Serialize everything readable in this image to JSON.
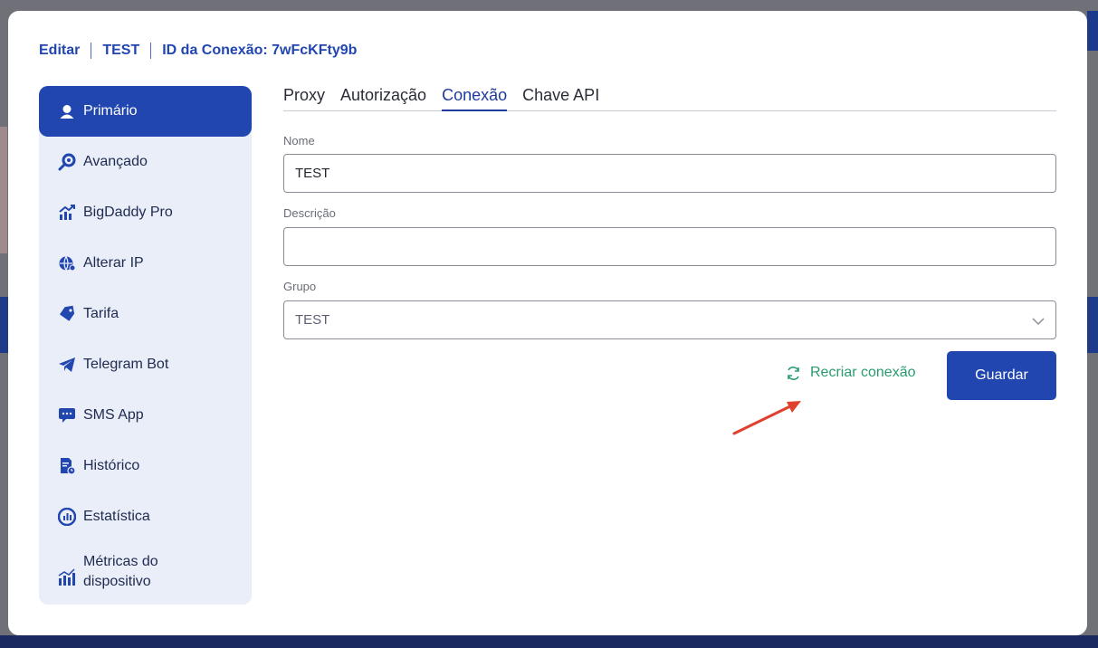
{
  "header": {
    "edit_label": "Editar",
    "name": "TEST",
    "connection_id": "ID da Conexão: 7wFcKFty9b"
  },
  "sidebar": {
    "items": [
      {
        "label": "Primário",
        "icon": "user-circle-icon",
        "active": true
      },
      {
        "label": "Avançado",
        "icon": "magnifier-gear-icon",
        "active": false
      },
      {
        "label": "BigDaddy Pro",
        "icon": "chart-growth-icon",
        "active": false
      },
      {
        "label": "Alterar IP",
        "icon": "globe-icon",
        "active": false
      },
      {
        "label": "Tarifa",
        "icon": "tag-icon",
        "active": false
      },
      {
        "label": "Telegram Bot",
        "icon": "paper-plane-icon",
        "active": false
      },
      {
        "label": "SMS App",
        "icon": "chat-bubble-icon",
        "active": false
      },
      {
        "label": "Histórico",
        "icon": "document-history-icon",
        "active": false
      },
      {
        "label": "Estatística",
        "icon": "stats-circle-icon",
        "active": false
      },
      {
        "label_line1": "Métricas do",
        "label_line2": "dispositivo",
        "icon": "bar-metrics-icon",
        "active": false
      }
    ]
  },
  "tabs": [
    {
      "label": "Proxy",
      "active": false
    },
    {
      "label": "Autorização",
      "active": false
    },
    {
      "label": "Conexão",
      "active": true
    },
    {
      "label": "Chave API",
      "active": false
    }
  ],
  "form": {
    "name_label": "Nome",
    "name_value": "TEST",
    "description_label": "Descrição",
    "description_value": "",
    "group_label": "Grupo",
    "group_value": "TEST"
  },
  "actions": {
    "recreate_label": "Recriar conexão",
    "save_label": "Guardar"
  },
  "colors": {
    "primary": "#2146b0",
    "sidebar_bg": "#e9eef8",
    "recreate_green": "#2a9d6e",
    "annotation_arrow": "#e0402e"
  }
}
